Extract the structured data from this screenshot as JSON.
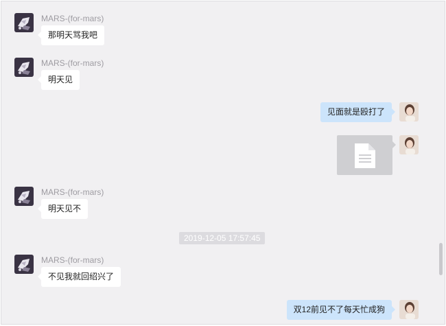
{
  "colors": {
    "background": "#f1f0f2",
    "incoming_bubble": "#ffffff",
    "outgoing_bubble": "#cce4fb",
    "sender_name": "#9d9ba1",
    "timestamp_bg": "#dcdbdf",
    "file_card": "#cfcfd2"
  },
  "messages": [
    {
      "direction": "incoming",
      "sender": "MARS-(for-mars)",
      "text": "那明天骂我吧"
    },
    {
      "direction": "incoming",
      "sender": "MARS-(for-mars)",
      "text": "明天见"
    },
    {
      "direction": "outgoing",
      "text": "见面就是殴打了"
    },
    {
      "direction": "outgoing",
      "type": "file",
      "icon": "document-icon"
    },
    {
      "direction": "incoming",
      "sender": "MARS-(for-mars)",
      "text": "明天见不"
    },
    {
      "type": "timestamp",
      "text": "2019-12-05 17:57:45"
    },
    {
      "direction": "incoming",
      "sender": "MARS-(for-mars)",
      "text": "不见我就回绍兴了"
    },
    {
      "direction": "outgoing",
      "text": "双12前见不了每天忙成狗"
    }
  ]
}
